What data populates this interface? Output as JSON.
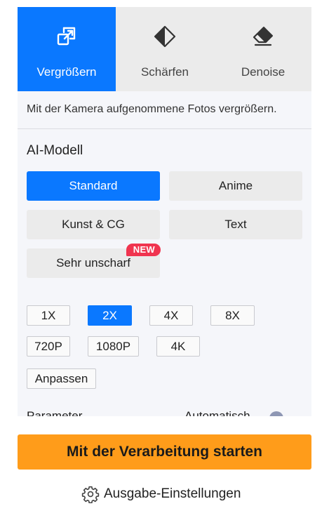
{
  "tabs": [
    {
      "label": "Vergrößern",
      "icon": "enlarge-icon",
      "active": true
    },
    {
      "label": "Schärfen",
      "icon": "sharpen-icon",
      "active": false
    },
    {
      "label": "Denoise",
      "icon": "eraser-icon",
      "active": false
    }
  ],
  "description": "Mit der Kamera aufgenommene Fotos vergrößern.",
  "ai_model": {
    "title": "AI-Modell",
    "options": [
      {
        "label": "Standard",
        "active": true
      },
      {
        "label": "Anime",
        "active": false
      },
      {
        "label": "Kunst & CG",
        "active": false
      },
      {
        "label": "Text",
        "active": false
      },
      {
        "label": "Sehr unscharf",
        "active": false,
        "badge": "NEW"
      }
    ]
  },
  "scale": {
    "options": [
      {
        "label": "1X",
        "active": false
      },
      {
        "label": "2X",
        "active": true
      },
      {
        "label": "4X",
        "active": false
      },
      {
        "label": "8X",
        "active": false
      },
      {
        "label": "720P",
        "active": false
      },
      {
        "label": "1080P",
        "active": false
      },
      {
        "label": "4K",
        "active": false
      }
    ],
    "custom_label": "Anpassen"
  },
  "parameter": {
    "label": "Parameter",
    "value": "Automatisch"
  },
  "start_button": "Mit der Verarbeitung starten",
  "output_settings": "Ausgabe-Einstellungen",
  "colors": {
    "accent": "#0a78ff",
    "start_button": "#ff9c1a",
    "badge": "#f0344f"
  }
}
